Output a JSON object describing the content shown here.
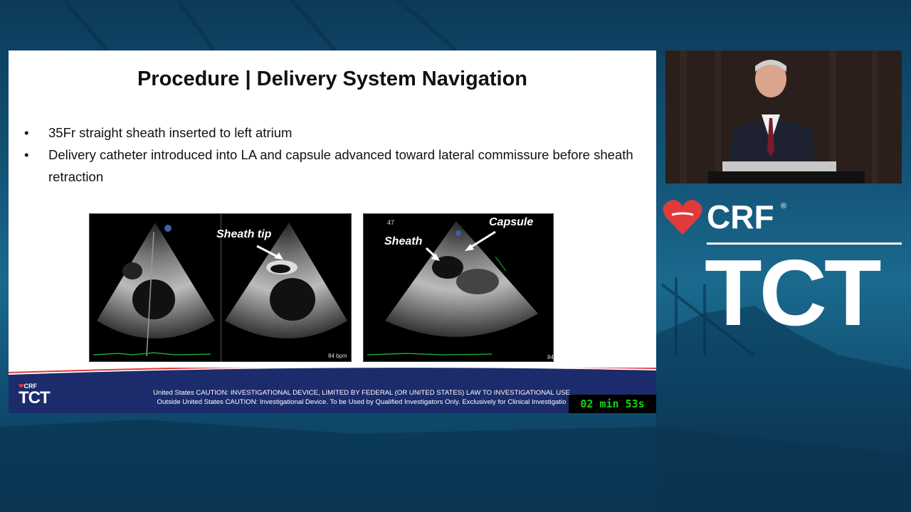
{
  "slide": {
    "title": "Procedure | Delivery System Navigation",
    "bullets": [
      "35Fr straight sheath inserted to left atrium",
      "Delivery catheter introduced into LA and capsule advanced toward lateral commissure before sheath retraction"
    ],
    "bullet_marker": "•",
    "images": {
      "left": {
        "label": "Sheath tip",
        "bpm": "84 bpm"
      },
      "right": {
        "label_sheath": "Sheath",
        "label_capsule": "Capsule",
        "corner_number": "47",
        "bpm": "84"
      }
    },
    "footer": {
      "logo_small": "CRF",
      "logo_large": "TCT",
      "caution_line1": "United States CAUTION: INVESTIGATIONAL DEVICE, LIMITED BY FEDERAL (OR UNITED STATES) LAW TO INVESTIGATIONAL USE",
      "caution_line2": "Outside United States CAUTION: Investigational Device. To be Used by Qualified Investigators Only. Exclusively for Clinical Investigatio"
    }
  },
  "timer": {
    "text": "02 min 53s"
  },
  "brand": {
    "crf": "CRF",
    "registered": "®",
    "tct": "TCT"
  },
  "colors": {
    "accent_red": "#e23a3a",
    "footer_navy": "#1c2b6b",
    "timer_green": "#14d414"
  }
}
